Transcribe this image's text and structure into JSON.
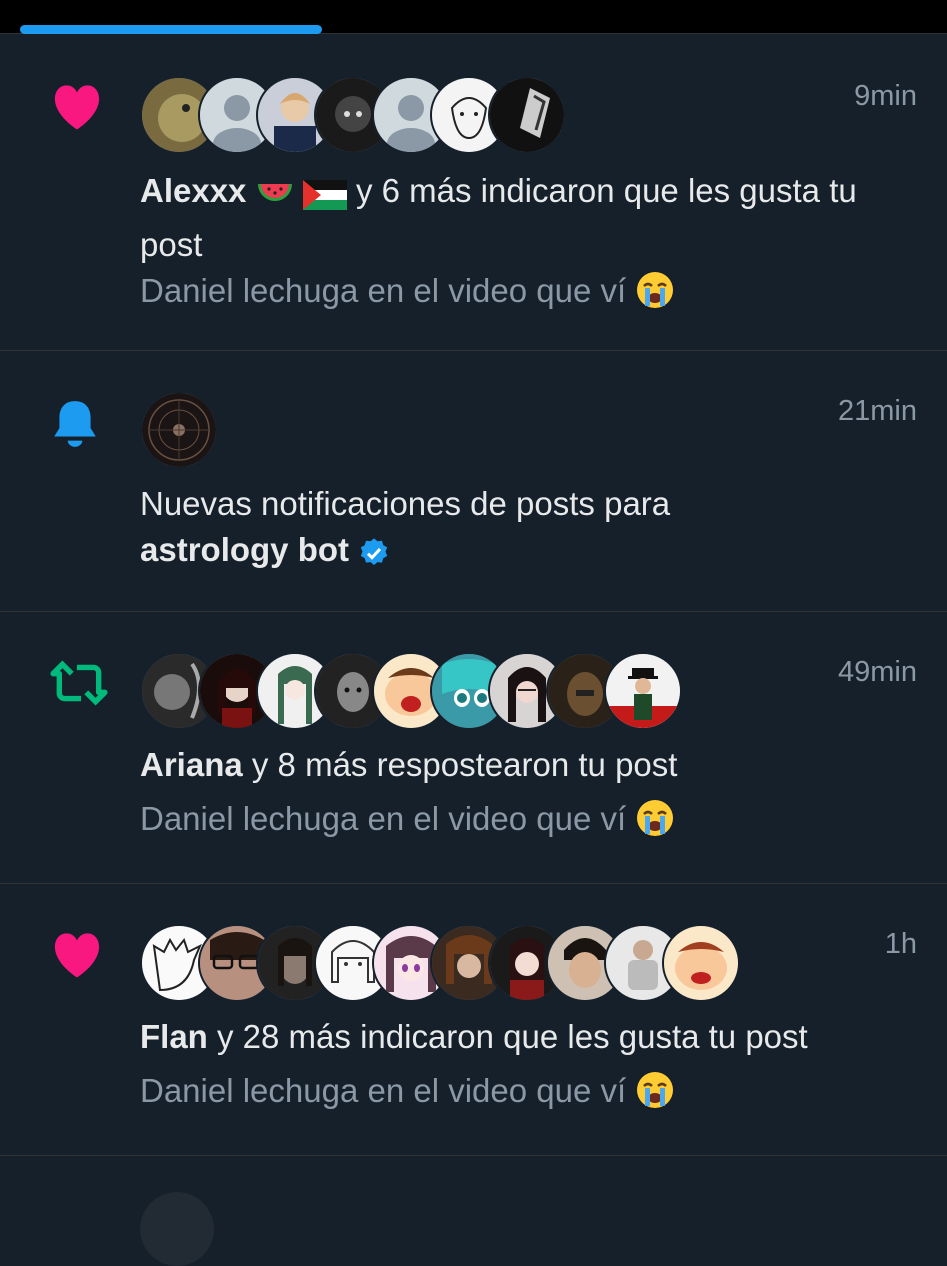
{
  "notifications": [
    {
      "type": "like",
      "icon": "heart-icon",
      "time": "9min",
      "actor": "Alexxx",
      "actor_emojis": [
        "watermelon-emoji",
        "palestine-flag-emoji"
      ],
      "text": "y 6 más indicaron que les gusta tu post",
      "post_text": "Daniel lechuga en el video que ví",
      "post_emoji": "loudly-crying-face-emoji",
      "avatar_count": 7
    },
    {
      "type": "post_notification",
      "icon": "bell-icon",
      "time": "21min",
      "text": "Nuevas notificaciones de posts para",
      "actor": "astrology bot",
      "verified_icon": "verified-badge-icon",
      "avatar_count": 1
    },
    {
      "type": "repost",
      "icon": "repost-icon",
      "time": "49min",
      "actor": "Ariana",
      "text": "y 8 más respostearon tu post",
      "post_text": "Daniel lechuga en el video que ví",
      "post_emoji": "loudly-crying-face-emoji",
      "avatar_count": 9
    },
    {
      "type": "like",
      "icon": "heart-icon",
      "time": "1h",
      "actor": "Flan",
      "text": "y 28 más indicaron que les gusta tu post",
      "post_text": "Daniel lechuga en el video que ví",
      "post_emoji": "loudly-crying-face-emoji",
      "avatar_count": 10
    }
  ],
  "colors": {
    "background": "#15202b",
    "like": "#f91880",
    "bell": "#1d9bf0",
    "repost": "#00ba7c",
    "text": "#e7e9ea",
    "muted": "#8b98a5",
    "divider": "#2f3336"
  }
}
